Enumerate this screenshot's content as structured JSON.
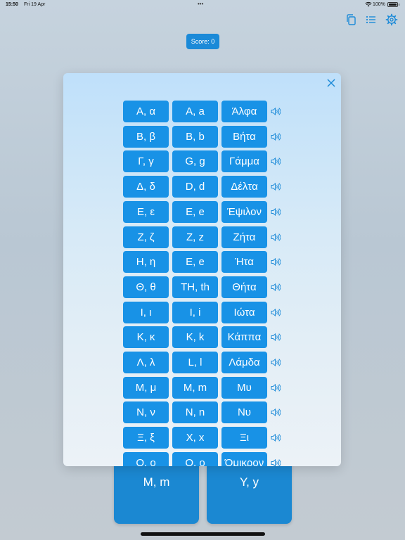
{
  "status_bar": {
    "time": "15:50",
    "date": "Fri 19 Apr",
    "battery": "100%"
  },
  "toolbar": {
    "icons": [
      "copy-icon",
      "list-icon",
      "gear-icon"
    ]
  },
  "score": {
    "label": "Score: 0"
  },
  "answers": {
    "left": "Μ, m",
    "right": "Υ, y"
  },
  "alphabet_modal": {
    "close_icon": "close-icon",
    "speaker_icon": "speaker-icon",
    "rows": [
      {
        "greek": "Α, α",
        "latin": "A, a",
        "name": "Άλφα"
      },
      {
        "greek": "Β, β",
        "latin": "B, b",
        "name": "Βήτα"
      },
      {
        "greek": "Γ, γ",
        "latin": "G, g",
        "name": "Γάμμα"
      },
      {
        "greek": "Δ, δ",
        "latin": "D, d",
        "name": "Δέλτα"
      },
      {
        "greek": "Ε, ε",
        "latin": "E, e",
        "name": "Έψιλον"
      },
      {
        "greek": "Ζ, ζ",
        "latin": "Z, z",
        "name": "Ζήτα"
      },
      {
        "greek": "Η, η",
        "latin": "E, e",
        "name": "Ήτα"
      },
      {
        "greek": "Θ, θ",
        "latin": "TH, th",
        "name": "Θήτα"
      },
      {
        "greek": "Ι, ι",
        "latin": "I, i",
        "name": "Ιώτα"
      },
      {
        "greek": "Κ, κ",
        "latin": "K, k",
        "name": "Κάππα"
      },
      {
        "greek": "Λ, λ",
        "latin": "L, l",
        "name": "Λάμδα"
      },
      {
        "greek": "Μ, μ",
        "latin": "M, m",
        "name": "Μυ"
      },
      {
        "greek": "Ν, ν",
        "latin": "N, n",
        "name": "Νυ"
      },
      {
        "greek": "Ξ, ξ",
        "latin": "X, x",
        "name": "Ξι"
      },
      {
        "greek": "Ο, ο",
        "latin": "O, o",
        "name": "Όμικρον"
      }
    ]
  },
  "colors": {
    "button_blue": "#1892e6",
    "accent": "#1b8ad8"
  }
}
